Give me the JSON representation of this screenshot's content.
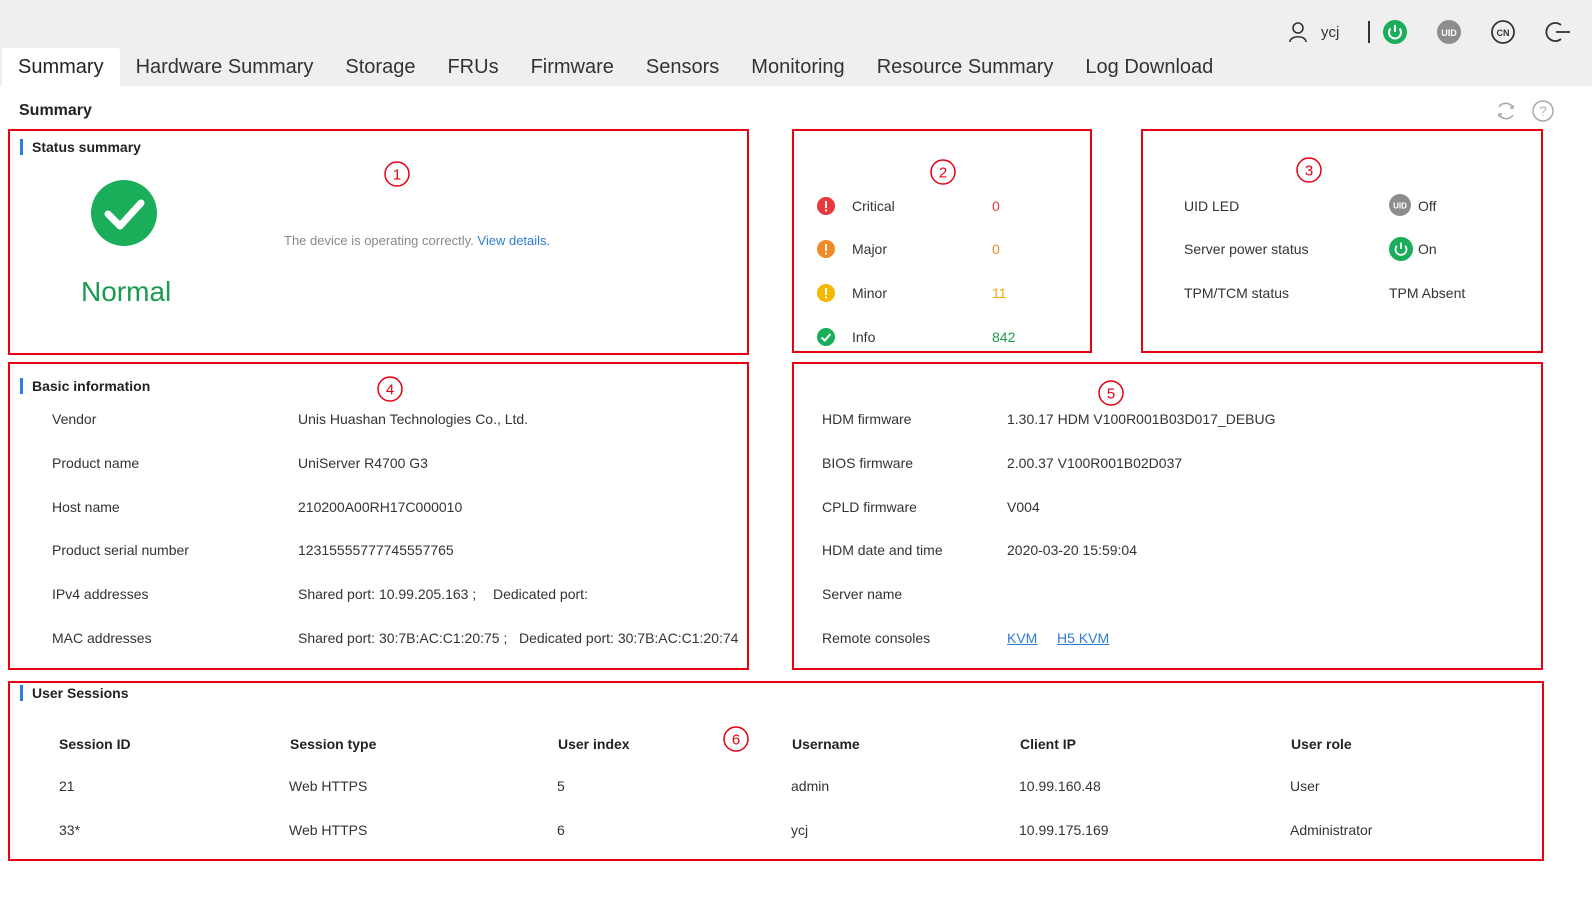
{
  "header": {
    "username": "ycj",
    "power_icon_color": "#1aae5a",
    "uid_icon_label": "UID",
    "lang_icon_label": "CN"
  },
  "tabs": [
    {
      "label": "Summary",
      "active": true
    },
    {
      "label": "Hardware Summary"
    },
    {
      "label": "Storage"
    },
    {
      "label": "FRUs"
    },
    {
      "label": "Firmware"
    },
    {
      "label": "Sensors"
    },
    {
      "label": "Monitoring"
    },
    {
      "label": "Resource Summary"
    },
    {
      "label": "Log Download"
    }
  ],
  "page": {
    "title": "Summary"
  },
  "markers": [
    "①",
    "②",
    "③",
    "④",
    "⑤",
    "⑥"
  ],
  "status_summary": {
    "heading": "Status summary",
    "state": "Normal",
    "message": "The device is operating correctly.",
    "details_link": "View details."
  },
  "alarms": [
    {
      "label": "Critical",
      "count": "0",
      "color": "#e8383d"
    },
    {
      "label": "Major",
      "count": "0",
      "color": "#f08a24"
    },
    {
      "label": "Minor",
      "count": "11",
      "color": "#f5b700"
    },
    {
      "label": "Info",
      "count": "842",
      "color": "#1aae5a"
    }
  ],
  "device_status": {
    "uid_led_label": "UID LED",
    "uid_led_icon": "UID",
    "uid_led_value": "Off",
    "power_label": "Server power status",
    "power_value": "On",
    "tpm_label": "TPM/TCM status",
    "tpm_value": "TPM Absent"
  },
  "basic_info": {
    "heading": "Basic information",
    "rows": [
      {
        "label": "Vendor",
        "value": "Unis Huashan Technologies Co., Ltd."
      },
      {
        "label": "Product name",
        "value": "UniServer R4700 G3"
      },
      {
        "label": "Host name",
        "value": "210200A00RH17C000010"
      },
      {
        "label": "Product serial number",
        "value": "12315555777745557765"
      },
      {
        "label": "IPv4 addresses",
        "value": "Shared port: 10.99.205.163 ;",
        "value2": "Dedicated port:"
      },
      {
        "label": "MAC addresses",
        "value": "Shared port: 30:7B:AC:C1:20:75 ;",
        "value2": "Dedicated port: 30:7B:AC:C1:20:74"
      }
    ]
  },
  "firmware_info": {
    "rows": [
      {
        "label": "HDM firmware",
        "value": "1.30.17 HDM V100R001B03D017_DEBUG"
      },
      {
        "label": "BIOS firmware",
        "value": "2.00.37 V100R001B02D037"
      },
      {
        "label": "CPLD firmware",
        "value": "V004"
      },
      {
        "label": "HDM date and time",
        "value": "2020-03-20 15:59:04"
      },
      {
        "label": "Server name",
        "value": ""
      },
      {
        "label": "Remote consoles",
        "links": [
          "KVM",
          "H5 KVM"
        ]
      }
    ]
  },
  "sessions": {
    "heading": "User Sessions",
    "columns": [
      "Session ID",
      "Session type",
      "User index",
      "Username",
      "Client IP",
      "User role"
    ],
    "rows": [
      [
        "21",
        "Web HTTPS",
        "5",
        "admin",
        "10.99.160.48",
        "User"
      ],
      [
        "33*",
        "Web HTTPS",
        "6",
        "ycj",
        "10.99.175.169",
        "Administrator"
      ]
    ]
  }
}
